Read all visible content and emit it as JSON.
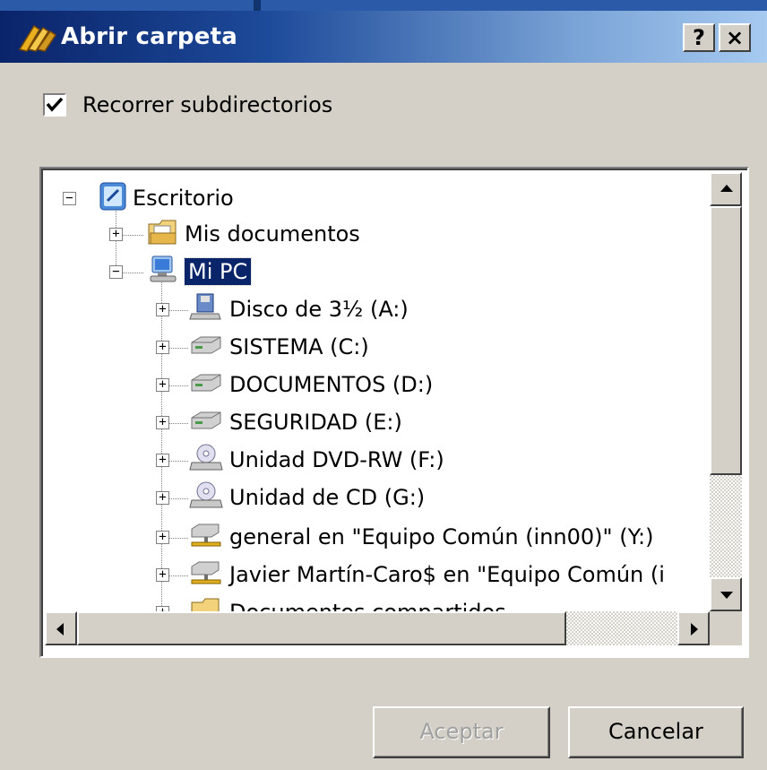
{
  "window": {
    "title": "Abrir carpeta",
    "help_label": "?",
    "close_label": "×"
  },
  "options": {
    "recurse_label": "Recorrer subdirectorios",
    "recurse_checked": true
  },
  "tree": {
    "desktop": "Escritorio",
    "my_documents": "Mis documentos",
    "my_pc": "Mi PC",
    "drives": [
      {
        "label": "Disco de 3½ (A:)",
        "icon": "floppy-drive-icon"
      },
      {
        "label": "SISTEMA (C:)",
        "icon": "hard-drive-icon"
      },
      {
        "label": "DOCUMENTOS (D:)",
        "icon": "hard-drive-icon"
      },
      {
        "label": "SEGURIDAD (E:)",
        "icon": "hard-drive-icon"
      },
      {
        "label": "Unidad DVD-RW (F:)",
        "icon": "optical-drive-icon"
      },
      {
        "label": "Unidad de CD (G:)",
        "icon": "optical-drive-icon"
      },
      {
        "label": "general en \"Equipo Común (inn00)\" (Y:)",
        "icon": "network-drive-icon"
      },
      {
        "label": "Javier Martín-Caro$ en \"Equipo Común (i",
        "icon": "network-drive-icon"
      },
      {
        "label": "Documentos compartidos",
        "icon": "folder-icon"
      }
    ],
    "selected": "Mi PC"
  },
  "buttons": {
    "ok_label": "Aceptar",
    "cancel_label": "Cancelar",
    "ok_enabled": false
  }
}
